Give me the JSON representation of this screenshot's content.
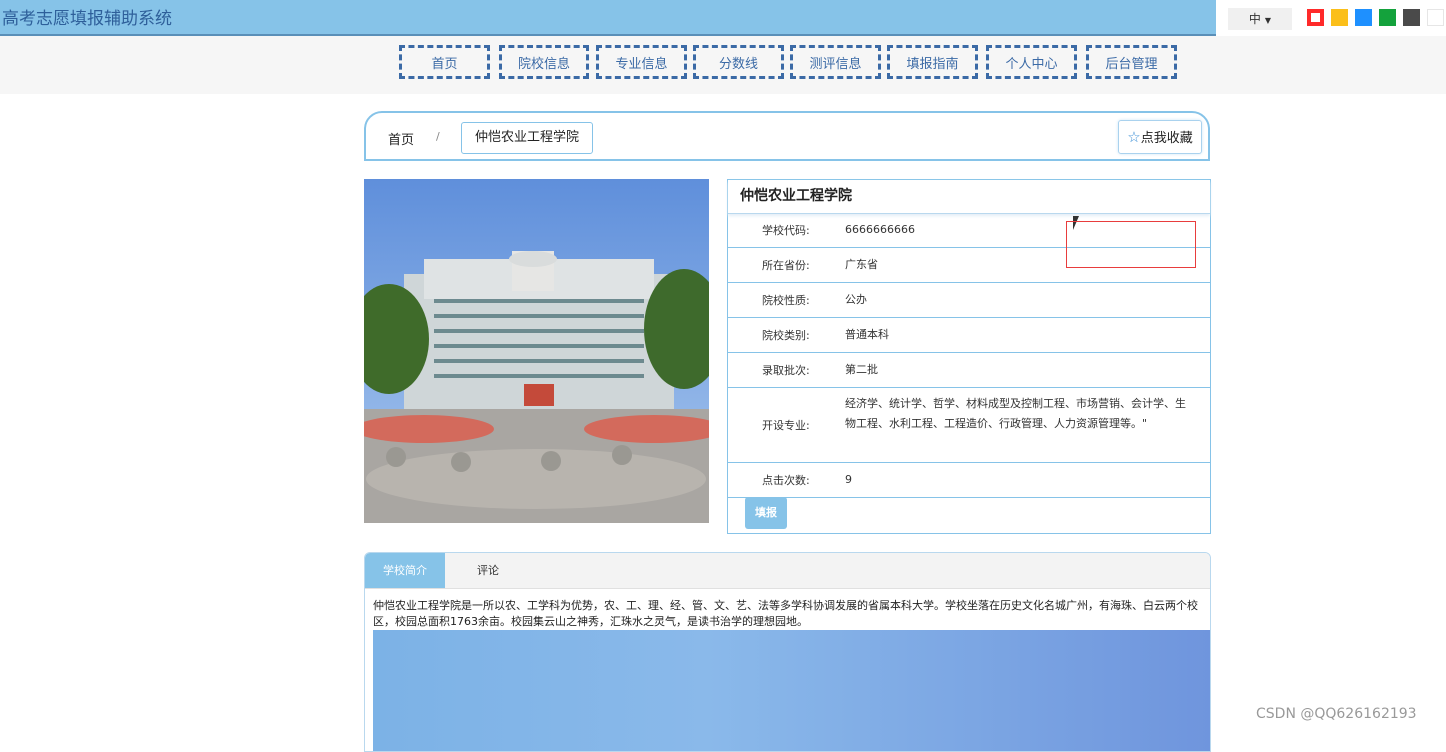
{
  "app": {
    "title": "高考志愿填报辅助系统"
  },
  "top_right": {
    "lang_label": "中",
    "theme_colors": [
      "#ff2a2a",
      "#fbbf1a",
      "#1e90ff",
      "#14a23c",
      "#4a4a4a",
      "#ffffff"
    ]
  },
  "nav": {
    "items": [
      "首页",
      "院校信息",
      "专业信息",
      "分数线",
      "测评信息",
      "填报指南",
      "个人中心",
      "后台管理"
    ]
  },
  "breadcrumb": {
    "home": "首页",
    "separator": "/",
    "current": "仲恺农业工程学院"
  },
  "favorite": {
    "label": "点我收藏"
  },
  "school": {
    "name": "仲恺农业工程学院",
    "fields": [
      {
        "key": "学校代码:",
        "value": "6666666666"
      },
      {
        "key": "所在省份:",
        "value": "广东省"
      },
      {
        "key": "院校性质:",
        "value": "公办"
      },
      {
        "key": "院校类别:",
        "value": "普通本科"
      },
      {
        "key": "录取批次:",
        "value": "第二批"
      },
      {
        "key": "开设专业:",
        "value": "经济学、统计学、哲学、材料成型及控制工程、市场营销、会计学、生物工程、水利工程、工程造价、行政管理、人力资源管理等。\""
      },
      {
        "key": "点击次数:",
        "value": "9"
      }
    ],
    "submit_label": "填报"
  },
  "tabs": {
    "items": [
      "学校简介",
      "评论"
    ],
    "active": "学校简介"
  },
  "intro": {
    "text": "仲恺农业工程学院是一所以农、工学科为优势，农、工、理、经、管、文、艺、法等多学科协调发展的省属本科大学。学校坐落在历史文化名城广州，有海珠、白云两个校区，校园总面积1763余亩。校园集云山之神秀，汇珠水之灵气，是读书治学的理想园地。"
  },
  "watermark": "CSDN @QQ626162193"
}
